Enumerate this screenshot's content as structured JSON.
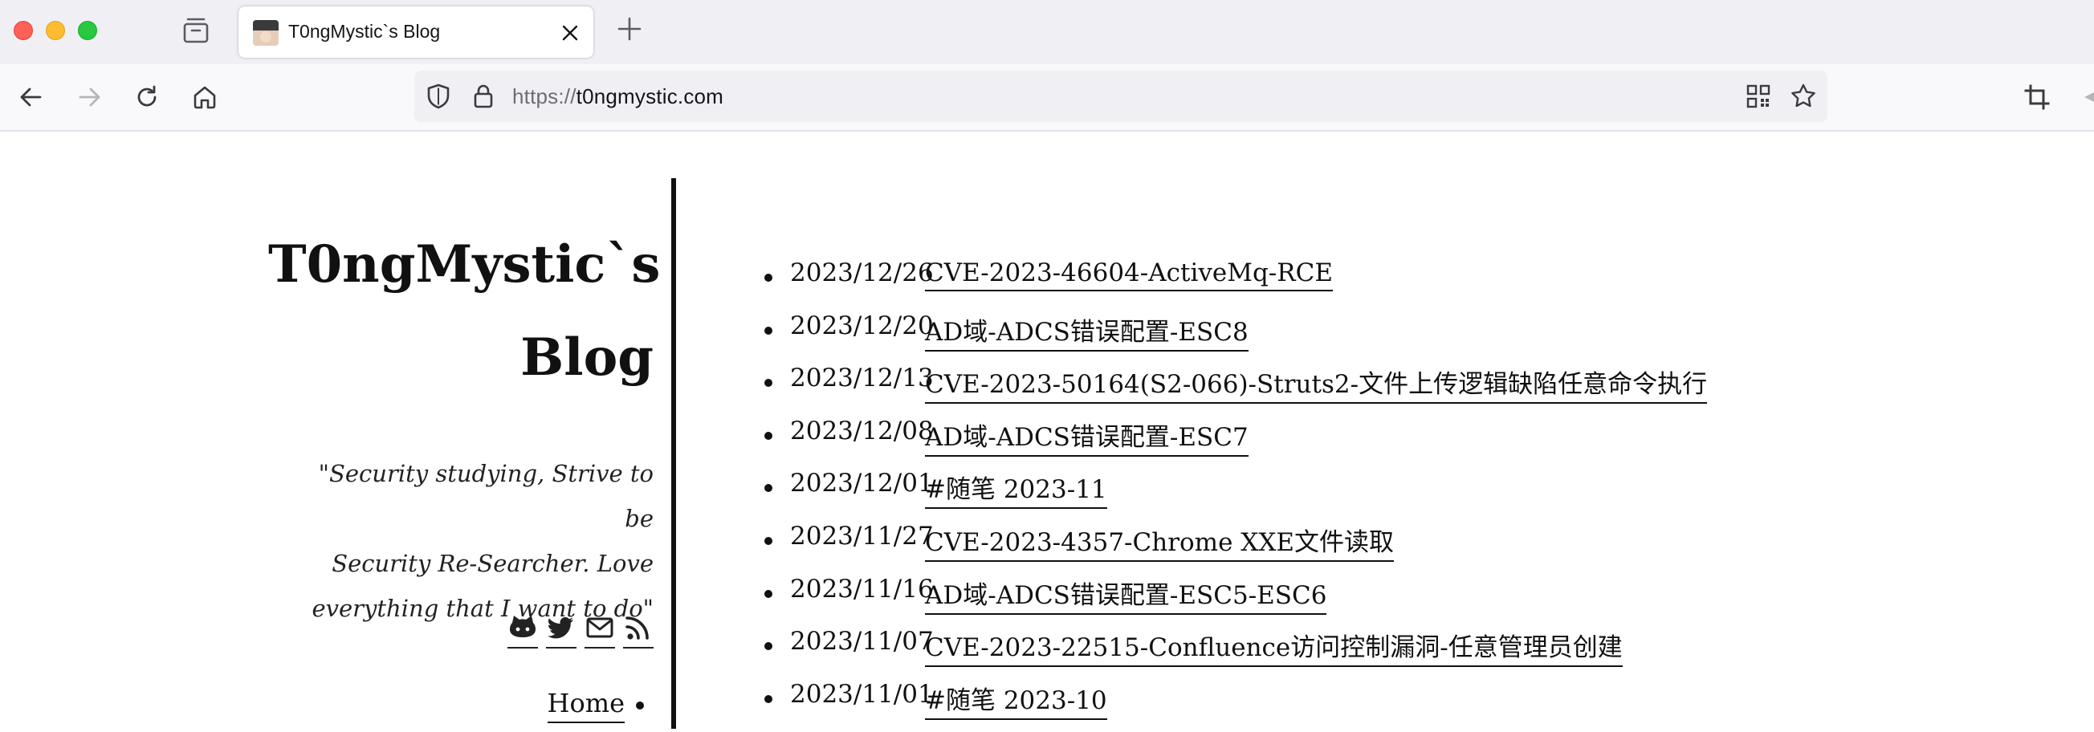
{
  "browser": {
    "tab_title": "T0ngMystic`s Blog",
    "url_protocol": "https://",
    "url_host": "t0ngmystic.com"
  },
  "sidebar": {
    "title_line1": "T0ngMystic`s",
    "title_line2": "Blog",
    "tagline_line1": "\"Security studying, Strive to be",
    "tagline_line2": "Security Re-Searcher. Love",
    "tagline_line3": "everything that I want to do\"",
    "social_icons": [
      "github-icon",
      "twitter-icon",
      "mail-icon",
      "rss-icon"
    ],
    "nav_home": "Home"
  },
  "posts": [
    {
      "date": "2023/12/26",
      "title": "CVE-2023-46604-ActiveMq-RCE"
    },
    {
      "date": "2023/12/20",
      "title": "AD域-ADCS错误配置-ESC8"
    },
    {
      "date": "2023/12/13",
      "title": "CVE-2023-50164(S2-066)-Struts2-文件上传逻辑缺陷任意命令执行"
    },
    {
      "date": "2023/12/08",
      "title": "AD域-ADCS错误配置-ESC7"
    },
    {
      "date": "2023/12/01",
      "title": "#随笔 2023-11"
    },
    {
      "date": "2023/11/27",
      "title": "CVE-2023-4357-Chrome XXE文件读取"
    },
    {
      "date": "2023/11/16",
      "title": "AD域-ADCS错误配置-ESC5-ESC6"
    },
    {
      "date": "2023/11/07",
      "title": "CVE-2023-22515-Confluence访问控制漏洞-任意管理员创建"
    },
    {
      "date": "2023/11/01",
      "title": "#随笔 2023-10"
    }
  ]
}
